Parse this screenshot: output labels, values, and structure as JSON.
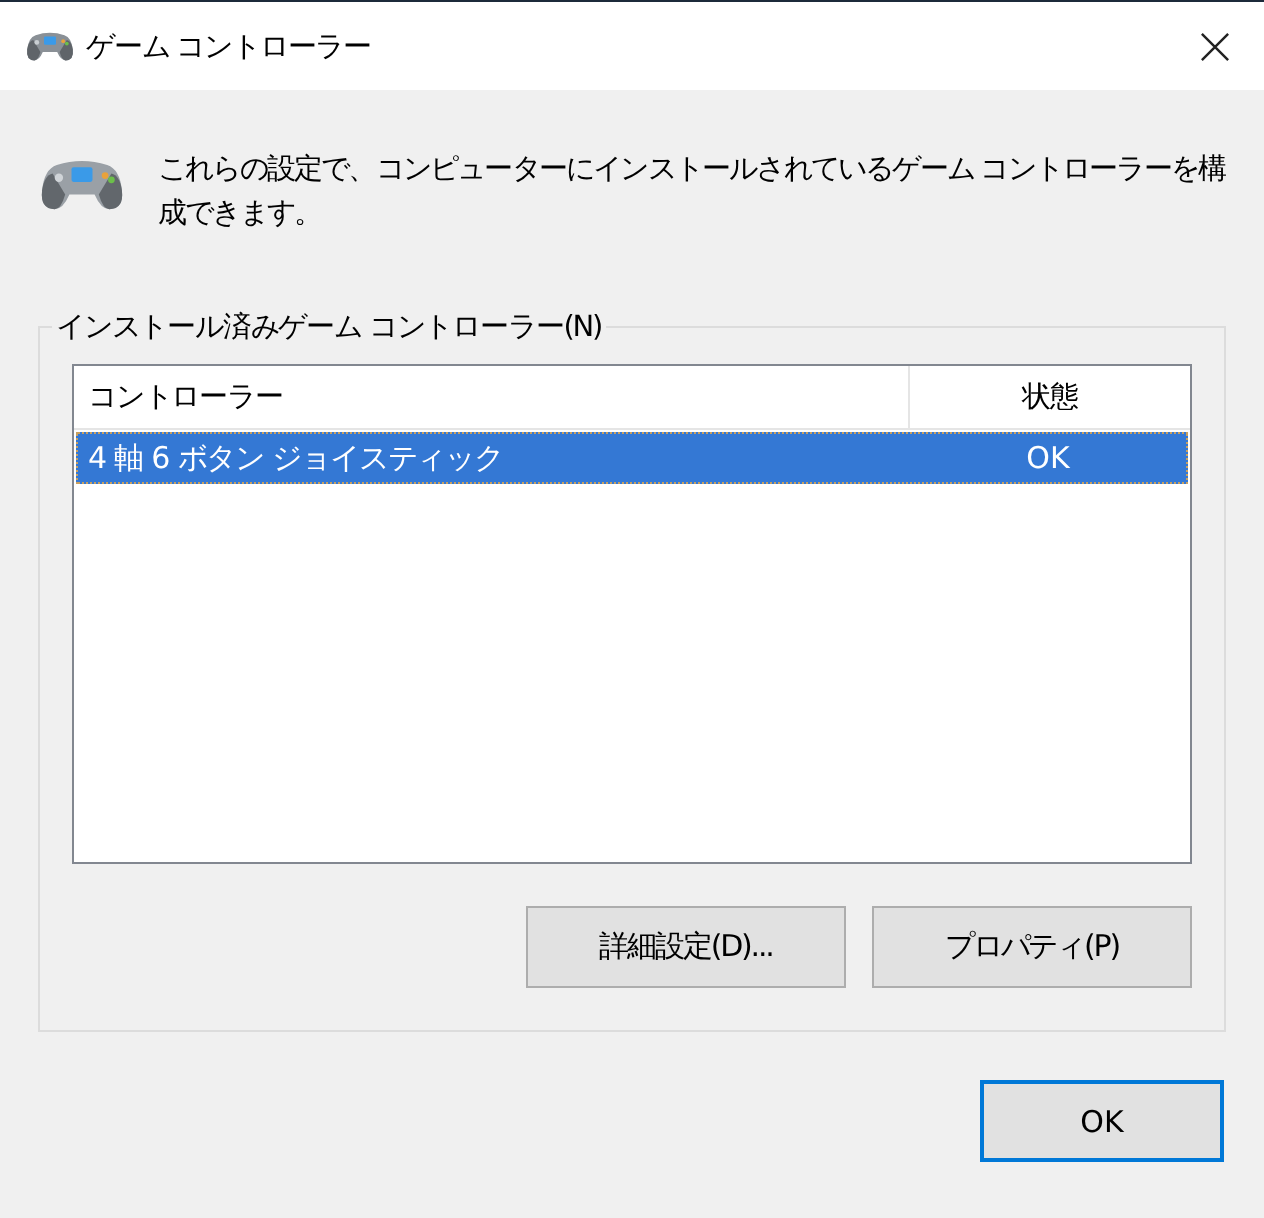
{
  "window": {
    "title": "ゲーム コントローラー"
  },
  "description": "これらの設定で、コンピューターにインストールされているゲーム コントローラーを構成できます。",
  "group": {
    "label": "インストール済みゲーム コントローラー(N)"
  },
  "table": {
    "columns": [
      "コントローラー",
      "状態"
    ],
    "rows": [
      {
        "controller": "4 軸 6 ボタン ジョイスティック",
        "status": "OK",
        "selected": true
      }
    ]
  },
  "buttons": [
    {
      "label": "詳細設定(D)..."
    },
    {
      "label": "プロパティ(P)"
    }
  ],
  "footer_buttons": [
    {
      "label": "OK",
      "default": true
    }
  ]
}
